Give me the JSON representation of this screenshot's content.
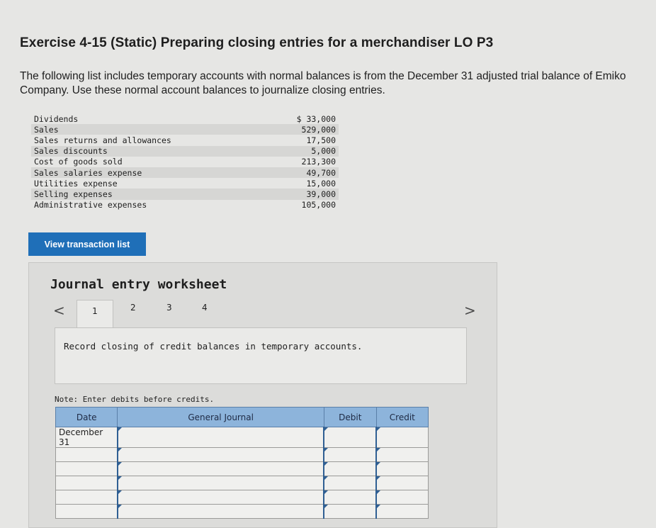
{
  "exercise_title": "Exercise 4-15 (Static) Preparing closing entries for a merchandiser LO P3",
  "intro": "The following list includes temporary accounts with normal balances is from the December 31 adjusted trial balance of Emiko Company. Use these normal account balances to journalize closing entries.",
  "accounts": [
    {
      "name": "Dividends",
      "amount": "$ 33,000"
    },
    {
      "name": "Sales",
      "amount": "529,000"
    },
    {
      "name": "Sales returns and allowances",
      "amount": "17,500"
    },
    {
      "name": "Sales discounts",
      "amount": "5,000"
    },
    {
      "name": "Cost of goods sold",
      "amount": "213,300"
    },
    {
      "name": "Sales salaries expense",
      "amount": "49,700"
    },
    {
      "name": "Utilities expense",
      "amount": "15,000"
    },
    {
      "name": "Selling expenses",
      "amount": "39,000"
    },
    {
      "name": "Administrative expenses",
      "amount": "105,000"
    }
  ],
  "view_button": "View transaction list",
  "worksheet": {
    "title": "Journal entry worksheet",
    "prev_icon": "<",
    "next_icon": ">",
    "tabs": [
      "1",
      "2",
      "3",
      "4"
    ],
    "instruction": "Record closing of credit balances in temporary accounts.",
    "note": "Note: Enter debits before credits.",
    "columns": {
      "date": "Date",
      "journal": "General Journal",
      "debit": "Debit",
      "credit": "Credit"
    },
    "first_date": "December 31"
  }
}
